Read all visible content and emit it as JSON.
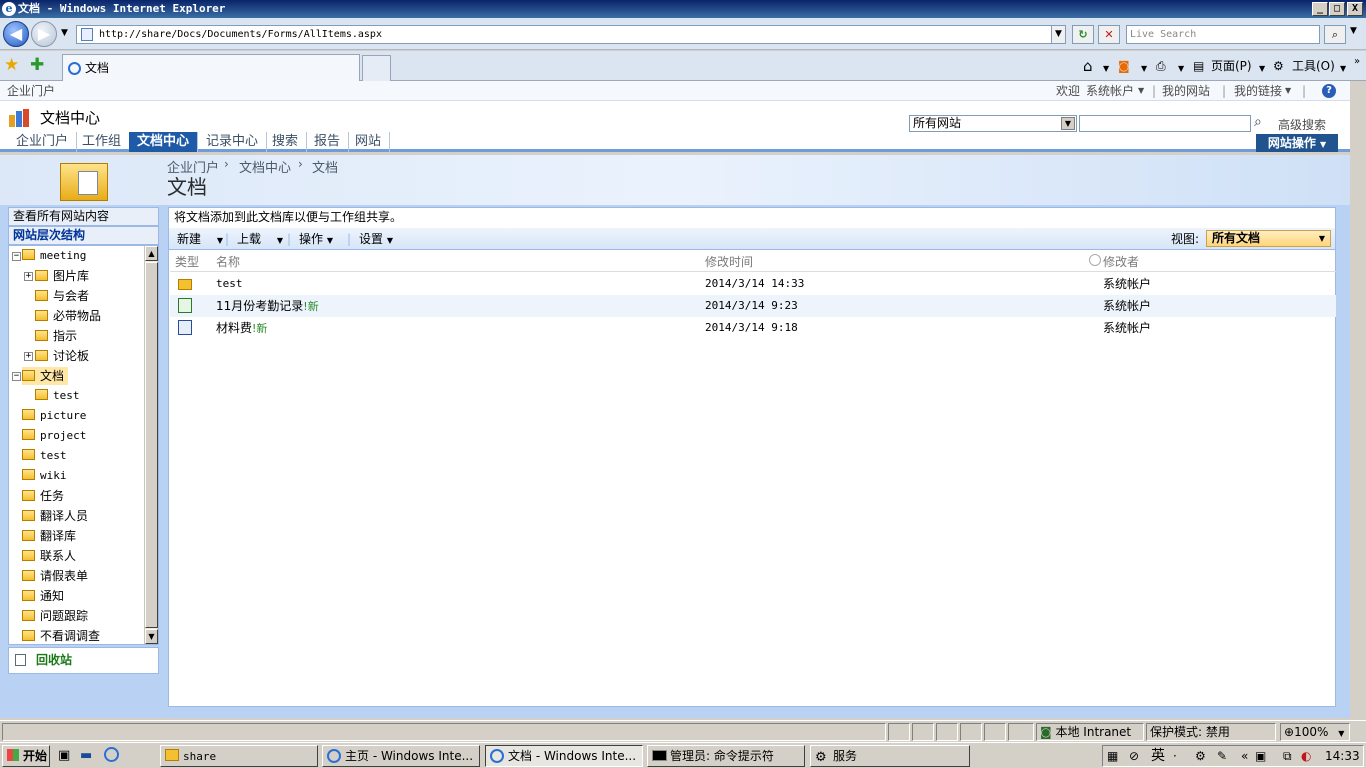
{
  "window": {
    "title": "文档 - Windows Internet Explorer",
    "min": "_",
    "max": "□",
    "close": "X"
  },
  "browser": {
    "url": "http://share/Docs/Documents/Forms/AllItems.aspx",
    "search_placeholder": "Live Search",
    "tab_label": "文档",
    "page_menu": "页面(P)",
    "tools_menu": "工具(O)"
  },
  "sharepoint": {
    "portal": "企业门户",
    "welcome": "欢迎",
    "account": "系统帐户",
    "my_site": "我的网站",
    "my_links": "我的链接",
    "site_title": "文档中心",
    "nav_tabs": [
      "企业门户",
      "工作组",
      "文档中心",
      "记录中心",
      "搜索",
      "报告",
      "网站"
    ],
    "scope": "所有网站",
    "advanced_search": "高级搜索",
    "site_actions": "网站操作",
    "breadcrumb": [
      "企业门户",
      "文档中心",
      "文档"
    ],
    "page_title": "文档",
    "view_all_content": "查看所有网站内容",
    "hierarchy": "网站层次结构",
    "tree": [
      {
        "label": "meeting",
        "mono": true,
        "level": 0,
        "expander": "⊟"
      },
      {
        "label": "图片库",
        "level": 1,
        "expander": "⊞"
      },
      {
        "label": "与会者",
        "level": 1
      },
      {
        "label": "必带物品",
        "level": 1
      },
      {
        "label": "指示",
        "level": 1
      },
      {
        "label": "讨论板",
        "level": 1,
        "expander": "⊞"
      },
      {
        "label": "文档",
        "level": 0,
        "expander": "⊟",
        "selected": true
      },
      {
        "label": "test",
        "mono": true,
        "level": 1
      },
      {
        "label": "picture",
        "mono": true,
        "level": 0
      },
      {
        "label": "project",
        "mono": true,
        "level": 0
      },
      {
        "label": "test",
        "mono": true,
        "level": 0
      },
      {
        "label": "wiki",
        "mono": true,
        "level": 0
      },
      {
        "label": "任务",
        "level": 0
      },
      {
        "label": "翻译人员",
        "level": 0
      },
      {
        "label": "翻译库",
        "level": 0
      },
      {
        "label": "联系人",
        "level": 0
      },
      {
        "label": "请假表单",
        "level": 0
      },
      {
        "label": "通知",
        "level": 0
      },
      {
        "label": "问题跟踪",
        "level": 0
      },
      {
        "label": "不看调调查",
        "level": 0
      }
    ],
    "recycle_bin": "回收站",
    "description": "将文档添加到此文档库以便与工作组共享。",
    "toolbar": {
      "new": "新建",
      "upload": "上载",
      "actions": "操作",
      "settings": "设置",
      "view_label": "视图:",
      "view_value": "所有文档"
    },
    "columns": {
      "type": "类型",
      "name": "名称",
      "modified": "修改时间",
      "modified_by": "修改者"
    },
    "documents": [
      {
        "type": "folder",
        "name": "test",
        "modified": "2014/3/14 14:33",
        "modified_by": "系统帐户",
        "new": ""
      },
      {
        "type": "excel",
        "name": "11月份考勤记录",
        "modified": "2014/3/14 9:23",
        "modified_by": "系统帐户",
        "new": "!新"
      },
      {
        "type": "word",
        "name": "材料费",
        "modified": "2014/3/14 9:18",
        "modified_by": "系统帐户",
        "new": "!新"
      }
    ]
  },
  "statusbar": {
    "zone": "本地 Intranet",
    "protected": "保护模式: 禁用",
    "zoom": "100%"
  },
  "taskbar": {
    "start": "开始",
    "buttons": [
      "share",
      "主页 - Windows Inte...",
      "文档 - Windows Inte...",
      "管理员: 命令提示符",
      "服务"
    ],
    "ime": "英",
    "clock": "14:33"
  }
}
